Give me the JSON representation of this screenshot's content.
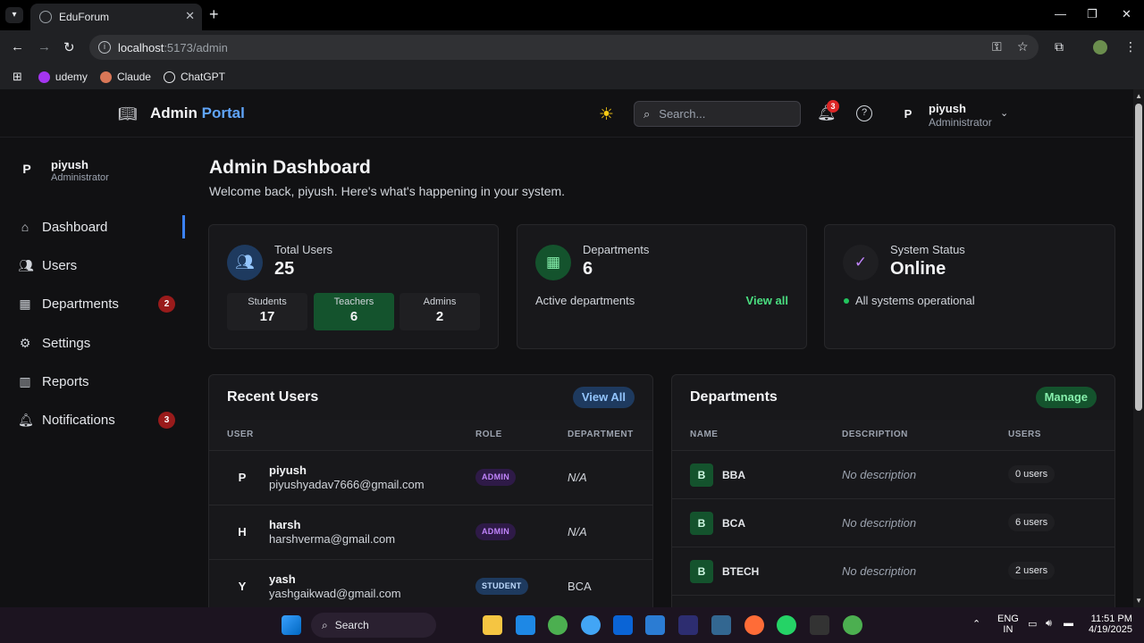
{
  "browser": {
    "tab_title": "EduForum",
    "url_host": "localhost",
    "url_path": ":5173/admin",
    "bookmarks": [
      "udemy",
      "Claude",
      "ChatGPT"
    ]
  },
  "header": {
    "brand_main": "Admin",
    "brand_accent": "Portal",
    "search_placeholder": "Search...",
    "notif_count": "3",
    "user_initial": "P",
    "user_name": "piyush",
    "user_role": "Administrator"
  },
  "sidebar": {
    "user_initial": "P",
    "user_name": "piyush",
    "user_role": "Administrator",
    "items": [
      {
        "label": "Dashboard"
      },
      {
        "label": "Users"
      },
      {
        "label": "Departments",
        "badge": "2"
      },
      {
        "label": "Settings"
      },
      {
        "label": "Reports"
      },
      {
        "label": "Notifications",
        "badge": "3"
      }
    ]
  },
  "main": {
    "title": "Admin Dashboard",
    "subtitle": "Welcome back, piyush. Here's what's happening in your system."
  },
  "stats": {
    "users": {
      "label": "Total Users",
      "value": "25",
      "breakdown": [
        {
          "label": "Students",
          "value": "17"
        },
        {
          "label": "Teachers",
          "value": "6"
        },
        {
          "label": "Admins",
          "value": "2"
        }
      ]
    },
    "departments": {
      "label": "Departments",
      "value": "6",
      "note": "Active departments",
      "link": "View all"
    },
    "system": {
      "label": "System Status",
      "value": "Online",
      "note": "All systems operational"
    }
  },
  "recent_users": {
    "title": "Recent Users",
    "action": "View All",
    "columns": [
      "USER",
      "ROLE",
      "DEPARTMENT"
    ],
    "rows": [
      {
        "initial": "P",
        "name": "piyush",
        "email": "piyushyadav7666@gmail.com",
        "role": "ADMIN",
        "department": "N/A"
      },
      {
        "initial": "H",
        "name": "harsh",
        "email": "harshverma@gmail.com",
        "role": "ADMIN",
        "department": "N/A"
      },
      {
        "initial": "Y",
        "name": "yash",
        "email": "yashgaikwad@gmail.com",
        "role": "STUDENT",
        "department": "BCA"
      }
    ]
  },
  "departments_panel": {
    "title": "Departments",
    "action": "Manage",
    "columns": [
      "NAME",
      "DESCRIPTION",
      "USERS"
    ],
    "rows": [
      {
        "initial": "B",
        "name": "BBA",
        "description": "No description",
        "users": "0 users"
      },
      {
        "initial": "B",
        "name": "BCA",
        "description": "No description",
        "users": "6 users"
      },
      {
        "initial": "B",
        "name": "BTECH",
        "description": "No description",
        "users": "2 users"
      }
    ]
  },
  "taskbar": {
    "search": "Search",
    "lang": "ENG",
    "region": "IN",
    "time": "11:51 PM",
    "date": "4/19/2025"
  }
}
